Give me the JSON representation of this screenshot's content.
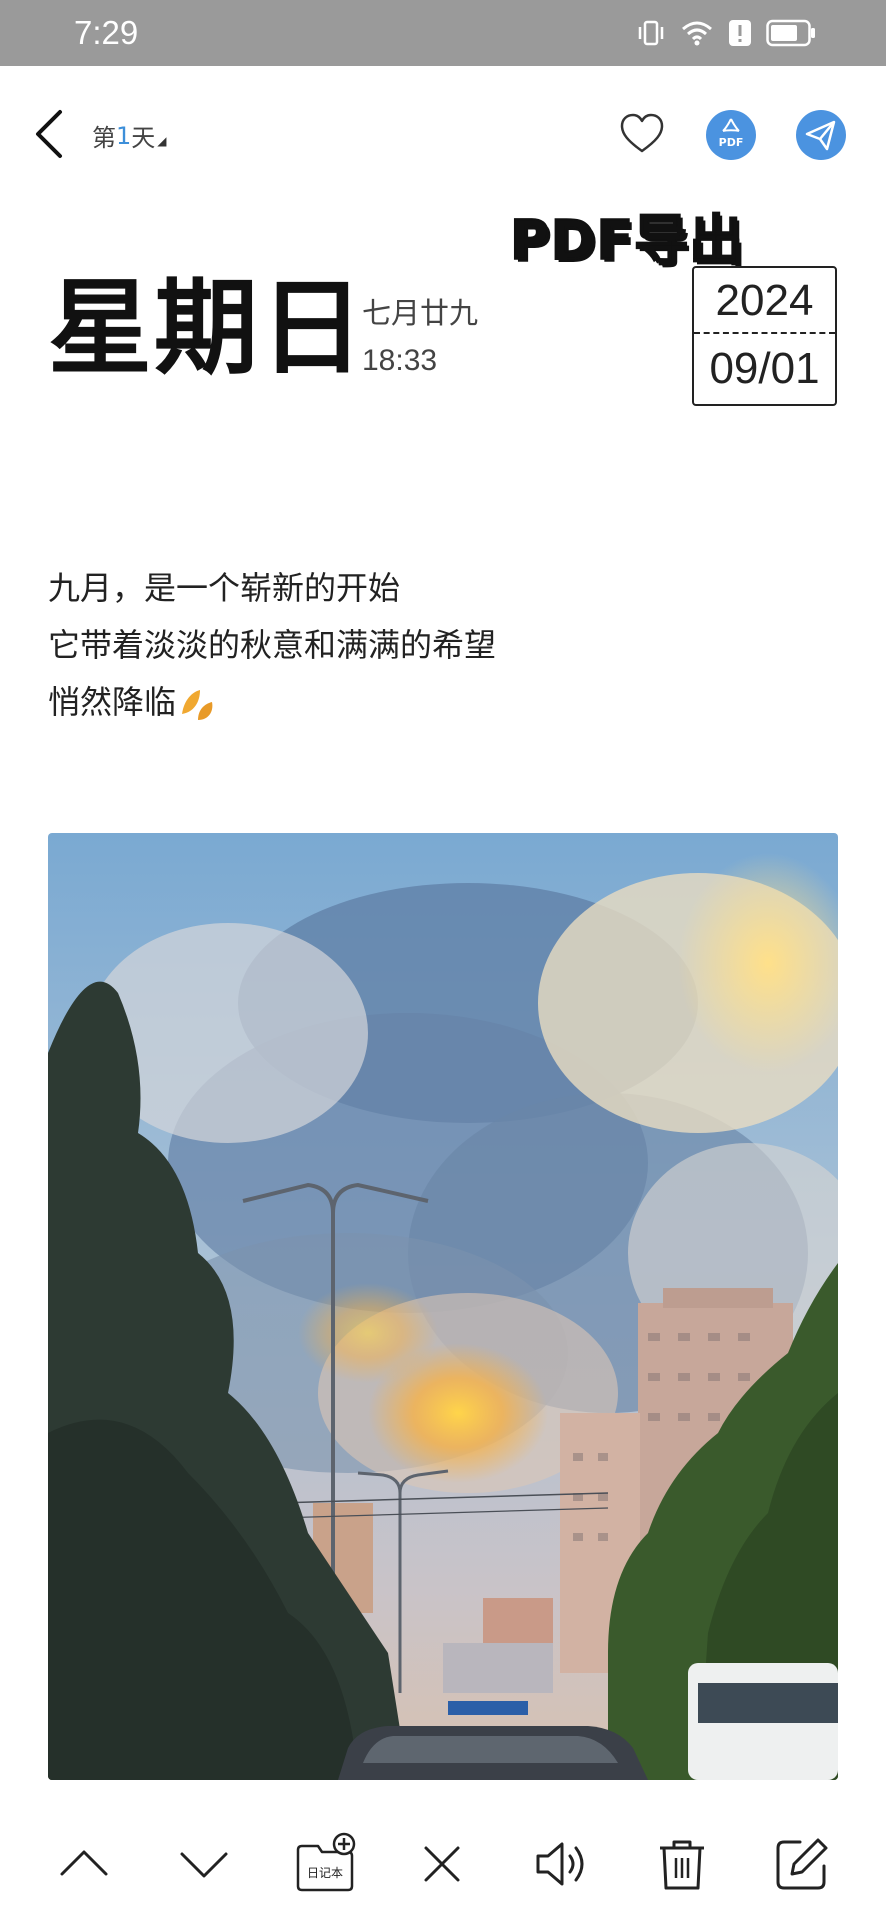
{
  "status_bar": {
    "time": "7:29"
  },
  "header": {
    "day_prefix": "第",
    "day_number": "1",
    "day_suffix": "天",
    "pdf_button_text": "PDF",
    "pdf_export_label": "PDF导出"
  },
  "entry": {
    "weekday": "星期日",
    "lunar_date": "七月廿九",
    "time": "18:33",
    "year": "2024",
    "month_day": "09/01",
    "lines": [
      "九月，是一个崭新的开始",
      "它带着淡淡的秋意和满满的希望",
      "悄然降临"
    ]
  },
  "toolbar": {
    "notebook_label": "日记本"
  },
  "colors": {
    "accent": "#4b93e0",
    "status_bar_bg": "#9a9a9a",
    "text": "#111111"
  },
  "icons": [
    "back-icon",
    "heart-icon",
    "pdf-icon",
    "send-icon",
    "leaf-icon",
    "chevron-up-icon",
    "chevron-down-icon",
    "notebook-add-icon",
    "close-icon",
    "speaker-icon",
    "trash-icon",
    "edit-icon"
  ]
}
